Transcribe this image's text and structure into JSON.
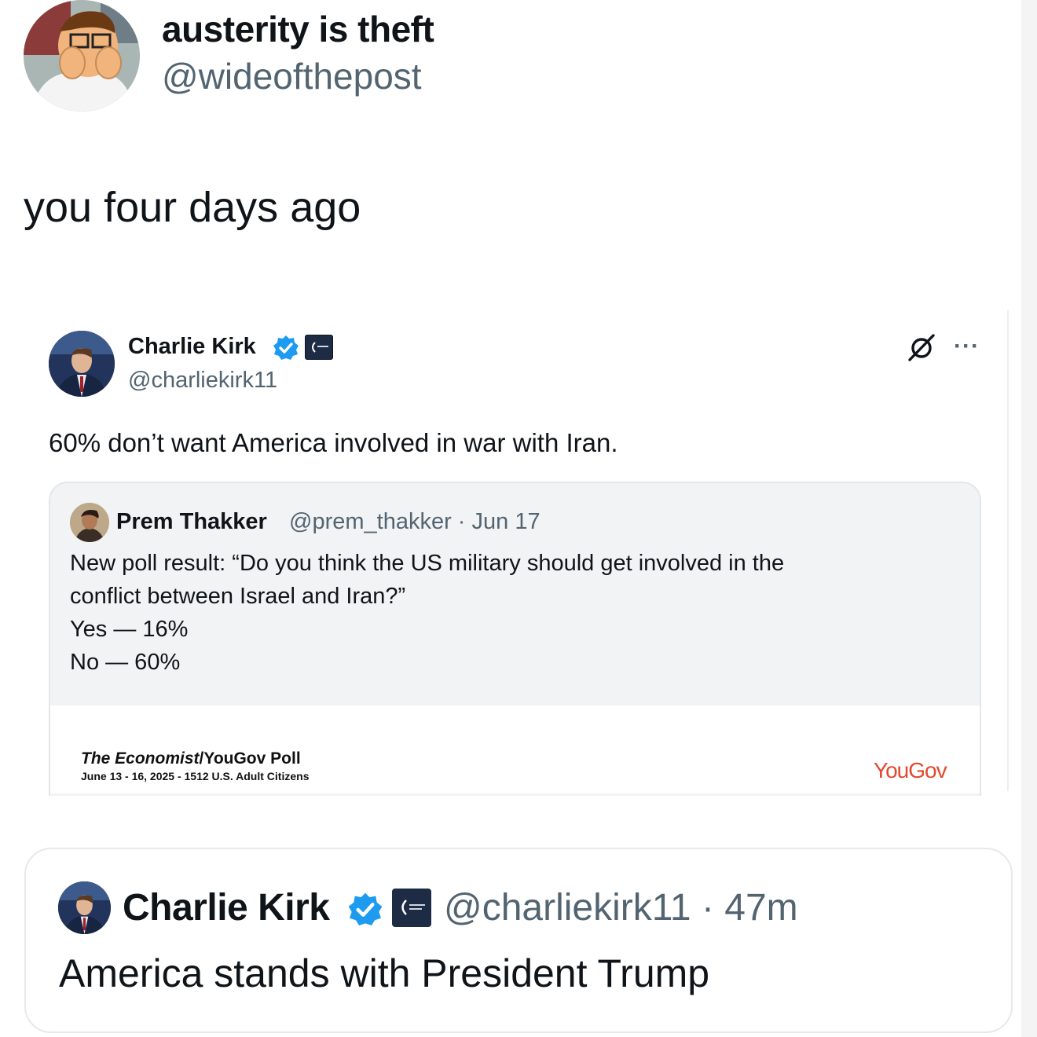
{
  "outer_tweet": {
    "display_name": "austerity is theft",
    "handle": "@wideofthepost",
    "text": "you four days ago"
  },
  "embedded_tweet": {
    "display_name": "Charlie Kirk",
    "handle": "@charliekirk11",
    "text": "60% don’t want America involved in war with Iran.",
    "icons": [
      "verified-badge-icon",
      "affiliation-badge-icon",
      "grok-icon",
      "more-icon"
    ],
    "more_label": "···",
    "quoted": {
      "display_name": "Prem Thakker",
      "meta": "@prem_thakker · Jun 17",
      "lines": [
        "New poll result: “Do you think the US military should get involved in the",
        "conflict between Israel and Iran?”",
        "Yes — 16%",
        "No — 60%"
      ],
      "poll_image": {
        "title_italic": "The Economist",
        "title_rest": "/YouGov Poll",
        "subtitle": "June 13 - 16, 2025 - 1512 U.S. Adult Citizens",
        "brand": "YouGov"
      }
    }
  },
  "second_tweet": {
    "display_name": "Charlie Kirk",
    "meta": "@charliekirk11 · 47m",
    "text": "America stands with President Trump"
  },
  "colors": {
    "text": "#0f1419",
    "secondary": "#536471",
    "verified": "#1d9bf0",
    "yougov": "#e2492f",
    "quote_bg": "#f2f3f4"
  }
}
